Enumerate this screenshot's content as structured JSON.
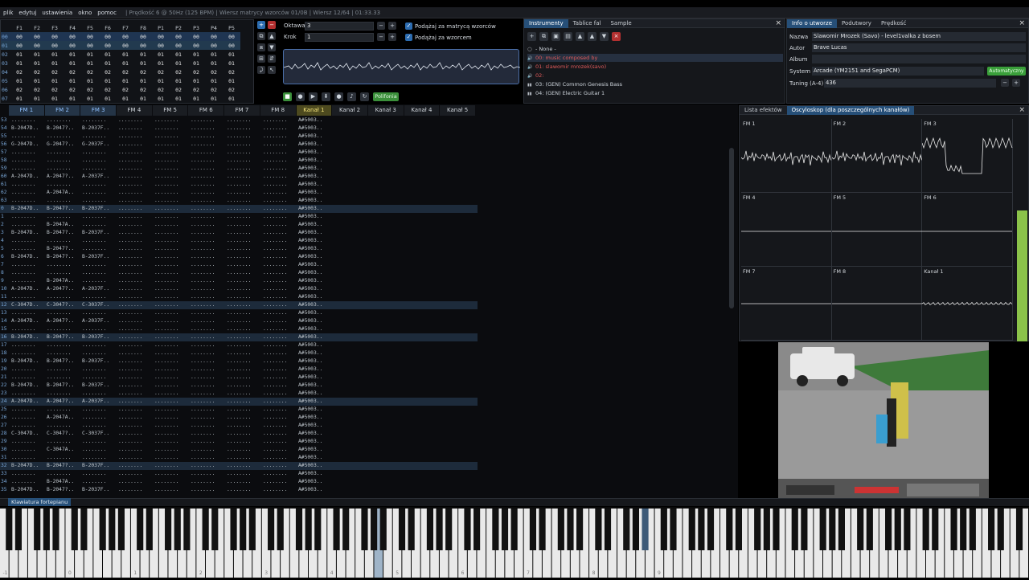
{
  "menu": {
    "items": [
      "plik",
      "edytuj",
      "ustawienia",
      "okno",
      "pomoc"
    ],
    "status": "| Prędkość 6 @ 50Hz (125 BPM) | Wiersz matrycy wzorców 01/0B | Wiersz 12/64 | 01:33.33"
  },
  "orders": {
    "headers": [
      "F1",
      "F2",
      "F3",
      "F4",
      "F5",
      "F6",
      "F7",
      "F8",
      "P1",
      "P2",
      "P3",
      "P4",
      "P5"
    ],
    "rows": [
      {
        "n": "00",
        "cells": [
          "00",
          "00",
          "00",
          "00",
          "00",
          "00",
          "00",
          "00",
          "00",
          "00",
          "00",
          "00",
          "00"
        ]
      },
      {
        "n": "01",
        "cells": [
          "00",
          "00",
          "00",
          "00",
          "00",
          "00",
          "00",
          "00",
          "00",
          "00",
          "00",
          "00",
          "00"
        ]
      },
      {
        "n": "02",
        "cells": [
          "01",
          "01",
          "01",
          "01",
          "01",
          "01",
          "01",
          "01",
          "01",
          "01",
          "01",
          "01",
          "01"
        ]
      },
      {
        "n": "03",
        "cells": [
          "01",
          "01",
          "01",
          "01",
          "01",
          "01",
          "01",
          "01",
          "01",
          "01",
          "01",
          "01",
          "01"
        ]
      },
      {
        "n": "04",
        "cells": [
          "02",
          "02",
          "02",
          "02",
          "02",
          "02",
          "02",
          "02",
          "02",
          "02",
          "02",
          "02",
          "02"
        ]
      },
      {
        "n": "05",
        "cells": [
          "01",
          "01",
          "01",
          "01",
          "01",
          "01",
          "01",
          "01",
          "01",
          "01",
          "01",
          "01",
          "01"
        ]
      },
      {
        "n": "06",
        "cells": [
          "02",
          "02",
          "02",
          "02",
          "02",
          "02",
          "02",
          "02",
          "02",
          "02",
          "02",
          "02",
          "02"
        ]
      },
      {
        "n": "07",
        "cells": [
          "01",
          "01",
          "01",
          "01",
          "01",
          "01",
          "01",
          "01",
          "01",
          "01",
          "01",
          "01",
          "01"
        ]
      }
    ]
  },
  "controls": {
    "octave_label": "Oktawa",
    "octave_value": "3",
    "step_label": "Krok",
    "step_value": "1",
    "follow_orders": "Podążaj za matrycą wzorców",
    "follow_pattern": "Podążaj za wzorcem",
    "polyphony": "Polifonia"
  },
  "instruments": {
    "tabs": [
      "Instrumenty",
      "Tablice fal",
      "Sample"
    ],
    "none": "- None -",
    "list": [
      {
        "label": "00: music composed by",
        "color": "#e05a5a"
      },
      {
        "label": "01: slawomir mrozek(savo)",
        "color": "#e05a5a"
      },
      {
        "label": "02:",
        "color": "#e05a5a"
      },
      {
        "label": "03: (GEN) Common Genesis Bass",
        "color": "#cfd6dd"
      },
      {
        "label": "04: (GEN) Electric Guitar 1",
        "color": "#cfd6dd"
      }
    ]
  },
  "info": {
    "tabs": [
      "Info o utworze",
      "Podutwory",
      "Prędkość"
    ],
    "name_label": "Nazwa",
    "name": "Slawomir Mrozek (Savo) - level1valka z bosem",
    "author_label": "Autor",
    "author": "Brave Lucas",
    "album_label": "Album",
    "album": "",
    "system_label": "System",
    "system": "Arcade (YM2151 and SegaPCM)",
    "auto_label": "Automatyczny",
    "tuning_label": "Tuning (A-4)",
    "tuning": "436"
  },
  "channels": [
    "FM 1",
    "FM 2",
    "FM 3",
    "FM 4",
    "FM 5",
    "FM 6",
    "FM 7",
    "FM 8",
    "Kanał 1",
    "Kanał 2",
    "Kanał 3",
    "Kanał 4",
    "Kanał 5"
  ],
  "pattern_rows": [
    {
      "n": "53",
      "a": "........",
      "b": "........",
      "c": "........",
      "k": "A#5003.."
    },
    {
      "n": "54",
      "a": "B-2047D..",
      "b": "B-2047?..",
      "c": "B-2037F..",
      "k": "A#5003.."
    },
    {
      "n": "55",
      "a": "........",
      "b": "........",
      "c": "........",
      "k": "A#5003.."
    },
    {
      "n": "56",
      "a": "G-2047D..",
      "b": "G-2047?..",
      "c": "G-2037F..",
      "k": "A#5003.."
    },
    {
      "n": "57",
      "a": "........",
      "b": "........",
      "c": "........",
      "k": "A#5003.."
    },
    {
      "n": "58",
      "a": "........",
      "b": "........",
      "c": "........",
      "k": "A#5003.."
    },
    {
      "n": "59",
      "a": "........",
      "b": "........",
      "c": "........",
      "k": "A#5003.."
    },
    {
      "n": "60",
      "a": "A-2047D..",
      "b": "A-2047?..",
      "c": "A-2037F..",
      "k": "A#5003.."
    },
    {
      "n": "61",
      "a": "........",
      "b": "........",
      "c": "........",
      "k": "A#5003.."
    },
    {
      "n": "62",
      "a": "........",
      "b": "A-2047A..",
      "c": "........",
      "k": "A#5003.."
    },
    {
      "n": "63",
      "a": "........",
      "b": "........",
      "c": "........",
      "k": "A#5003.."
    },
    {
      "n": "0",
      "a": "B-2047D..",
      "b": "B-2047?..",
      "c": "B-2037F..",
      "k": "A#5003..",
      "hl": true
    },
    {
      "n": "1",
      "a": "........",
      "b": "........",
      "c": "........",
      "k": "A#5003.."
    },
    {
      "n": "2",
      "a": "........",
      "b": "B-2047A..",
      "c": "........",
      "k": "A#5003.."
    },
    {
      "n": "3",
      "a": "B-2047D..",
      "b": "B-2047?..",
      "c": "B-2037F..",
      "k": "A#5003.."
    },
    {
      "n": "4",
      "a": "........",
      "b": "........",
      "c": "........",
      "k": "A#5003.."
    },
    {
      "n": "5",
      "a": "........",
      "b": "B-2047?..",
      "c": "........",
      "k": "A#5003.."
    },
    {
      "n": "6",
      "a": "B-2047D..",
      "b": "B-2047?..",
      "c": "B-2037F..",
      "k": "A#5003.."
    },
    {
      "n": "7",
      "a": "........",
      "b": "........",
      "c": "........",
      "k": "A#5003.."
    },
    {
      "n": "8",
      "a": "........",
      "b": "........",
      "c": "........",
      "k": "A#5003.."
    },
    {
      "n": "9",
      "a": "........",
      "b": "B-2047A..",
      "c": "........",
      "k": "A#5003.."
    },
    {
      "n": "10",
      "a": "A-2047D..",
      "b": "A-2047?..",
      "c": "A-2037F..",
      "k": "A#5003.."
    },
    {
      "n": "11",
      "a": "........",
      "b": "........",
      "c": "........",
      "k": "A#5003.."
    },
    {
      "n": "12",
      "a": "C-3047D..",
      "b": "C-3047?..",
      "c": "C-3037F..",
      "k": "A#5003..",
      "hl": true
    },
    {
      "n": "13",
      "a": "........",
      "b": "........",
      "c": "........",
      "k": "A#5003.."
    },
    {
      "n": "14",
      "a": "A-2047D..",
      "b": "A-2047?..",
      "c": "A-2037F..",
      "k": "A#5003.."
    },
    {
      "n": "15",
      "a": "........",
      "b": "........",
      "c": "........",
      "k": "A#5003.."
    },
    {
      "n": "16",
      "a": "B-2047D..",
      "b": "B-2047?..",
      "c": "B-2037F..",
      "k": "A#5003..",
      "hl": true
    },
    {
      "n": "17",
      "a": "........",
      "b": "........",
      "c": "........",
      "k": "A#5003.."
    },
    {
      "n": "18",
      "a": "........",
      "b": "........",
      "c": "........",
      "k": "A#5003.."
    },
    {
      "n": "19",
      "a": "B-2047D..",
      "b": "B-2047?..",
      "c": "B-2037F..",
      "k": "A#5003.."
    },
    {
      "n": "20",
      "a": "........",
      "b": "........",
      "c": "........",
      "k": "A#5003.."
    },
    {
      "n": "21",
      "a": "........",
      "b": "........",
      "c": "........",
      "k": "A#5003.."
    },
    {
      "n": "22",
      "a": "B-2047D..",
      "b": "B-2047?..",
      "c": "B-2037F..",
      "k": "A#5003.."
    },
    {
      "n": "23",
      "a": "........",
      "b": "........",
      "c": "........",
      "k": "A#5003.."
    },
    {
      "n": "24",
      "a": "A-2047D..",
      "b": "A-2047?..",
      "c": "A-2037F..",
      "k": "A#5003..",
      "hl": true
    },
    {
      "n": "25",
      "a": "........",
      "b": "........",
      "c": "........",
      "k": "A#5003.."
    },
    {
      "n": "26",
      "a": "........",
      "b": "A-2047A..",
      "c": "........",
      "k": "A#5003.."
    },
    {
      "n": "27",
      "a": "........",
      "b": "........",
      "c": "........",
      "k": "A#5003.."
    },
    {
      "n": "28",
      "a": "C-3047D..",
      "b": "C-3047?..",
      "c": "C-3037F..",
      "k": "A#5003.."
    },
    {
      "n": "29",
      "a": "........",
      "b": "........",
      "c": "........",
      "k": "A#5003.."
    },
    {
      "n": "30",
      "a": "........",
      "b": "C-3047A..",
      "c": "........",
      "k": "A#5003.."
    },
    {
      "n": "31",
      "a": "........",
      "b": "........",
      "c": "........",
      "k": "A#5003.."
    },
    {
      "n": "32",
      "a": "B-2047D..",
      "b": "B-2047?..",
      "c": "B-2037F..",
      "k": "A#5003..",
      "hl": true
    },
    {
      "n": "33",
      "a": "........",
      "b": "........",
      "c": "........",
      "k": "A#5003.."
    },
    {
      "n": "34",
      "a": "........",
      "b": "B-2047A..",
      "c": "........",
      "k": "A#5003.."
    },
    {
      "n": "35",
      "a": "B-2047D..",
      "b": "B-2047?..",
      "c": "B-2037F..",
      "k": "A#5003.."
    }
  ],
  "effects": {
    "tabs": [
      "Lista efektów",
      "Oscyloskop (dla poszczególnych kanałów)"
    ],
    "cells": [
      "FM 1",
      "FM 2",
      "FM 3",
      "FM 4",
      "FM 5",
      "FM 6",
      "FM 7",
      "FM 8",
      "Kanał 1"
    ]
  },
  "keyboard": {
    "tab": "Klawiatura fortepianu",
    "octave_labels": [
      "-1",
      "0",
      "1",
      "2",
      "3",
      "4",
      "5",
      "6",
      "7",
      "8",
      "9"
    ]
  },
  "colors": {
    "accent": "#264f78",
    "green": "#3a9f3a",
    "kanal_header": "#4d4a1f"
  }
}
